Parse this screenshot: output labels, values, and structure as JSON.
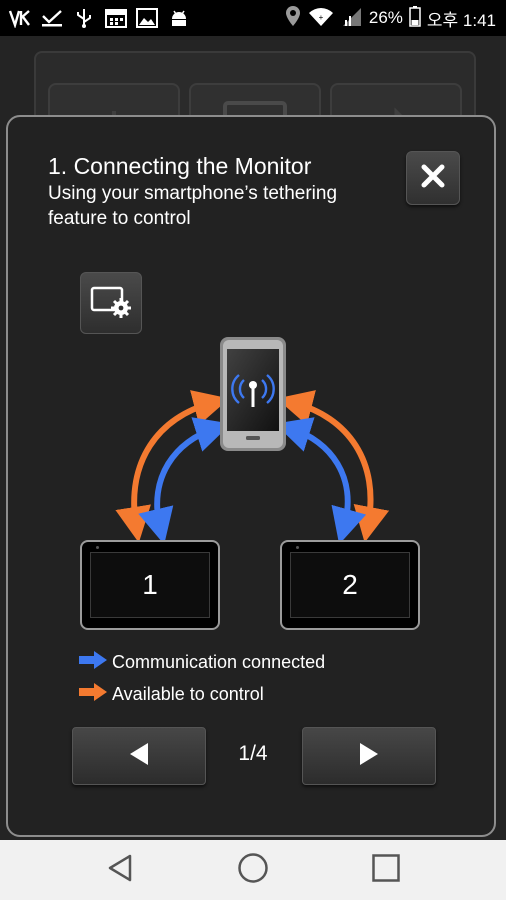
{
  "status_bar": {
    "battery_percent": "26%",
    "time_label": "오후 1:41",
    "icons": [
      "vlingo-icon",
      "download-done-icon",
      "usb-icon",
      "calendar-icon",
      "image-icon",
      "android-icon",
      "location-icon",
      "wifi-icon",
      "signal-icon",
      "battery-icon"
    ]
  },
  "dialog": {
    "title": "1. Connecting the Monitor",
    "subtitle": "Using your smartphone’s tethering feature to control",
    "monitors": [
      {
        "label": "1"
      },
      {
        "label": "2"
      }
    ],
    "legend": [
      {
        "color": "#3d78f0",
        "label": "Communication connected"
      },
      {
        "color": "#f47a30",
        "label": "Available to control"
      }
    ],
    "pager": {
      "text": "1/4",
      "current": 1,
      "total": 4
    }
  },
  "colors": {
    "blue_arrow": "#3d78f0",
    "orange_arrow": "#f47a30",
    "dialog_border": "#8d8d8d"
  },
  "navbar": {
    "buttons": [
      "back-icon",
      "home-icon",
      "recents-icon"
    ]
  }
}
